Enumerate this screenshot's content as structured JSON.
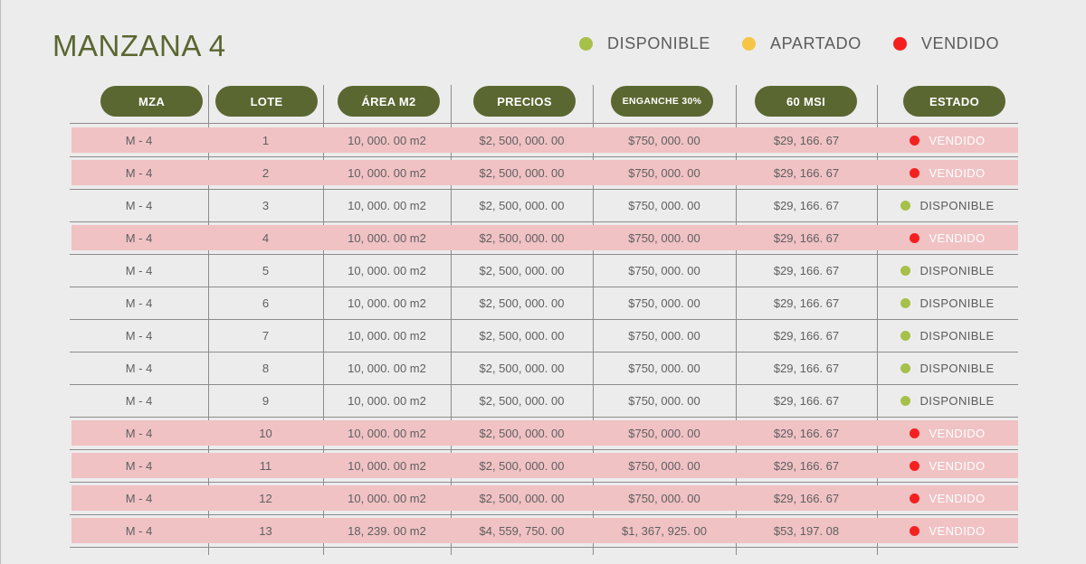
{
  "title": "MANZANA 4",
  "legend": [
    {
      "label": "DISPONIBLE",
      "color": "#a6c04a"
    },
    {
      "label": "APARTADO",
      "color": "#f7c545"
    },
    {
      "label": "VENDIDO",
      "color": "#f42020"
    }
  ],
  "columns": [
    "MZA",
    "LOTE",
    "ÁREA M2",
    "PRECIOS",
    "ENGANCHE 30%",
    "60 MSI",
    "ESTADO"
  ],
  "rows": [
    {
      "mza": "M - 4",
      "lote": "1",
      "area": "10, 000. 00 m2",
      "precio": "$2, 500, 000. 00",
      "enganche": "$750, 000. 00",
      "msi": "$29, 166. 67",
      "estado": "VENDIDO"
    },
    {
      "mza": "M - 4",
      "lote": "2",
      "area": "10, 000. 00 m2",
      "precio": "$2, 500, 000. 00",
      "enganche": "$750, 000. 00",
      "msi": "$29, 166. 67",
      "estado": "VENDIDO"
    },
    {
      "mza": "M - 4",
      "lote": "3",
      "area": "10, 000. 00 m2",
      "precio": "$2, 500, 000. 00",
      "enganche": "$750, 000. 00",
      "msi": "$29, 166. 67",
      "estado": "DISPONIBLE"
    },
    {
      "mza": "M - 4",
      "lote": "4",
      "area": "10, 000. 00 m2",
      "precio": "$2, 500, 000. 00",
      "enganche": "$750, 000. 00",
      "msi": "$29, 166. 67",
      "estado": "VENDIDO"
    },
    {
      "mza": "M - 4",
      "lote": "5",
      "area": "10, 000. 00 m2",
      "precio": "$2, 500, 000. 00",
      "enganche": "$750, 000. 00",
      "msi": "$29, 166. 67",
      "estado": "DISPONIBLE"
    },
    {
      "mza": "M - 4",
      "lote": "6",
      "area": "10, 000. 00 m2",
      "precio": "$2, 500, 000. 00",
      "enganche": "$750, 000. 00",
      "msi": "$29, 166. 67",
      "estado": "DISPONIBLE"
    },
    {
      "mza": "M - 4",
      "lote": "7",
      "area": "10, 000. 00 m2",
      "precio": "$2, 500, 000. 00",
      "enganche": "$750, 000. 00",
      "msi": "$29, 166. 67",
      "estado": "DISPONIBLE"
    },
    {
      "mza": "M - 4",
      "lote": "8",
      "area": "10, 000. 00 m2",
      "precio": "$2, 500, 000. 00",
      "enganche": "$750, 000. 00",
      "msi": "$29, 166. 67",
      "estado": "DISPONIBLE"
    },
    {
      "mza": "M - 4",
      "lote": "9",
      "area": "10, 000. 00 m2",
      "precio": "$2, 500, 000. 00",
      "enganche": "$750, 000. 00",
      "msi": "$29, 166. 67",
      "estado": "DISPONIBLE"
    },
    {
      "mza": "M - 4",
      "lote": "10",
      "area": "10, 000. 00 m2",
      "precio": "$2, 500, 000. 00",
      "enganche": "$750, 000. 00",
      "msi": "$29, 166. 67",
      "estado": "VENDIDO"
    },
    {
      "mza": "M - 4",
      "lote": "11",
      "area": "10, 000. 00 m2",
      "precio": "$2, 500, 000. 00",
      "enganche": "$750, 000. 00",
      "msi": "$29, 166. 67",
      "estado": "VENDIDO"
    },
    {
      "mza": "M - 4",
      "lote": "12",
      "area": "10, 000. 00 m2",
      "precio": "$2, 500, 000. 00",
      "enganche": "$750, 000. 00",
      "msi": "$29, 166. 67",
      "estado": "VENDIDO"
    },
    {
      "mza": "M - 4",
      "lote": "13",
      "area": "18, 239. 00 m2",
      "precio": "$4, 559, 750. 00",
      "enganche": "$1, 367, 925. 00",
      "msi": "$53, 197. 08",
      "estado": "VENDIDO"
    }
  ]
}
